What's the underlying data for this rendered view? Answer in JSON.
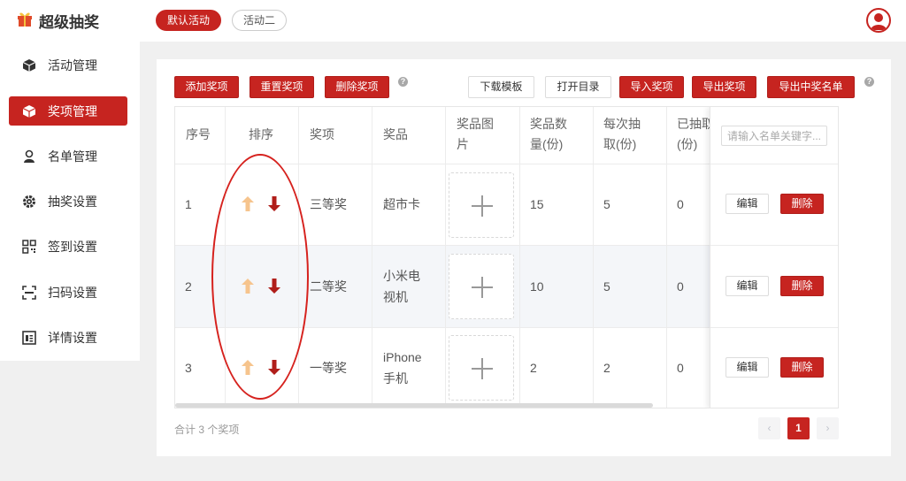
{
  "app": {
    "title": "超级抽奖"
  },
  "activity_tabs": [
    {
      "label": "默认活动",
      "active": true
    },
    {
      "label": "活动二",
      "active": false
    }
  ],
  "sidebar": {
    "items": [
      {
        "label": "活动管理",
        "icon": "cube-icon",
        "active": false
      },
      {
        "label": "奖项管理",
        "icon": "gift-box-icon",
        "active": true
      },
      {
        "label": "名单管理",
        "icon": "user-icon",
        "active": false
      },
      {
        "label": "抽奖设置",
        "icon": "gear-icon",
        "active": false
      },
      {
        "label": "签到设置",
        "icon": "qrcode-icon",
        "active": false
      },
      {
        "label": "扫码设置",
        "icon": "scan-icon",
        "active": false
      },
      {
        "label": "详情设置",
        "icon": "detail-icon",
        "active": false
      }
    ]
  },
  "toolbar": {
    "add": "添加奖项",
    "reset": "重置奖项",
    "delete": "删除奖项",
    "download_template": "下载模板",
    "open_dir": "打开目录",
    "import": "导入奖项",
    "export": "导出奖项",
    "export_winners": "导出中奖名单",
    "help": "?"
  },
  "table": {
    "headers": {
      "index": "序号",
      "sort": "排序",
      "prize_level": "奖项",
      "prize": "奖品",
      "image": [
        "奖品图",
        "片"
      ],
      "count": [
        "奖品数",
        "量(份)"
      ],
      "per_draw": [
        "每次抽",
        "取(份)"
      ],
      "drawn": [
        "已抽取",
        "(份)"
      ]
    },
    "search_placeholder": "请输入名单关键字...",
    "rows": [
      {
        "index": "1",
        "level": "三等奖",
        "prize": [
          "超市卡"
        ],
        "count": "15",
        "per_draw": "5",
        "drawn": "0",
        "edit": "编辑",
        "delete": "删除"
      },
      {
        "index": "2",
        "level": "二等奖",
        "prize": [
          "小米电",
          "视机"
        ],
        "count": "10",
        "per_draw": "5",
        "drawn": "0",
        "edit": "编辑",
        "delete": "删除"
      },
      {
        "index": "3",
        "level": "一等奖",
        "prize": [
          "iPhone",
          "手机"
        ],
        "count": "2",
        "per_draw": "2",
        "drawn": "0",
        "edit": "编辑",
        "delete": "删除"
      }
    ]
  },
  "footer": {
    "total": "合计 3 个奖项"
  },
  "pagination": {
    "prev": "‹",
    "current": "1",
    "next": "›"
  },
  "colors": {
    "accent": "#c62420",
    "arrow_up": "#f6c48d",
    "arrow_down": "#b01e1a"
  }
}
